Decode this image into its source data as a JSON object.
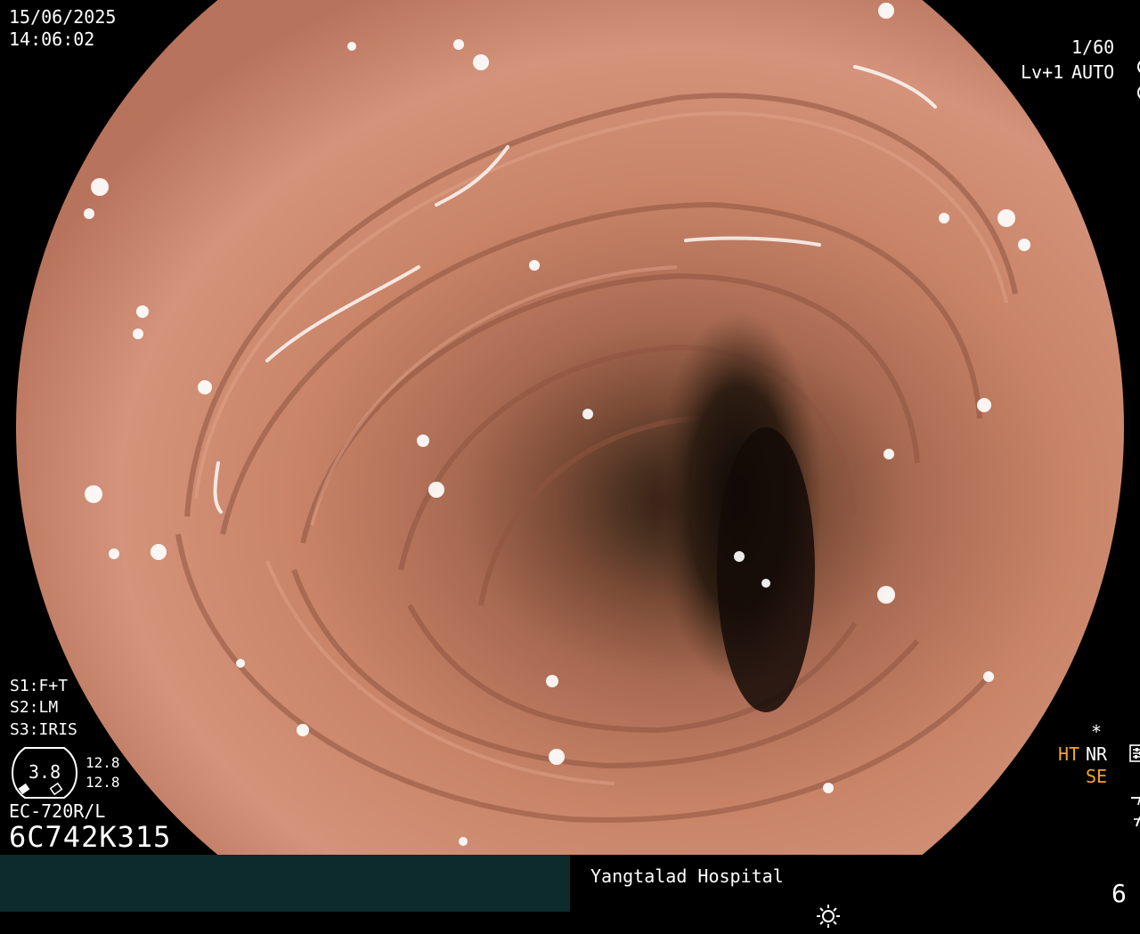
{
  "header": {
    "date": "15/06/2025",
    "time": "14:06:02",
    "shutter": "1/60",
    "shutter_icon": "aperture-icon",
    "level": "Lv+1",
    "auto": "AUTO",
    "auto_icon": "iris-icon"
  },
  "settings": {
    "s1_key": "S1:",
    "s1_val": "F+T",
    "s2_key": "S2:",
    "s2_val": "LM",
    "s3_key": "S3:",
    "s3_val": "IRIS",
    "gauge_value": "3.8",
    "gauge_top": "12.8",
    "gauge_bottom": "12.8",
    "model": "EC-720R/L",
    "serial": "6C742K315"
  },
  "modes": {
    "star": "*",
    "settings_icon": "sliders-icon",
    "ht": "HT",
    "nr": "NR",
    "se": "SE",
    "se_icon": "curve-icon",
    "f_icon": "f-curve-icon",
    "ht_color": "#f5a623",
    "se_color": "#f5a623"
  },
  "footer": {
    "hospital": "Yangtalad Hospital",
    "light_icon": "sun-icon",
    "count": "6"
  }
}
